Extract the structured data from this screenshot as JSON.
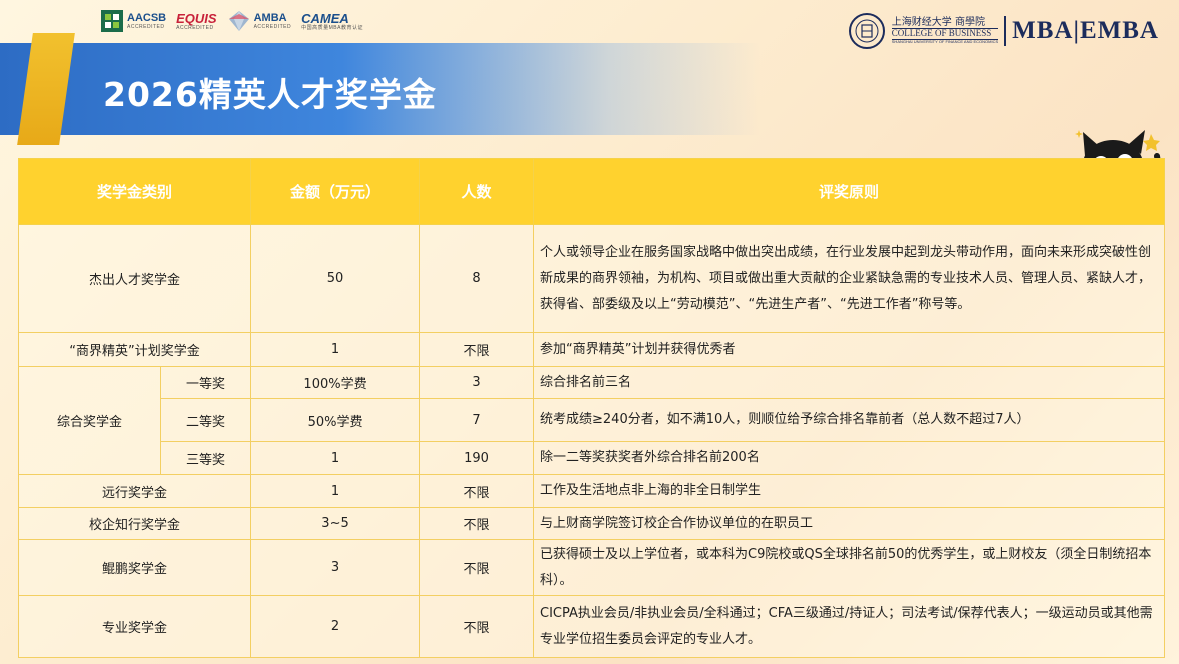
{
  "accreditations": [
    {
      "name": "AACSB",
      "sub": "ACCREDITED",
      "icon": "aacsb-logo"
    },
    {
      "name": "EQUIS",
      "sub": "ACCREDITED",
      "icon": "equis-logo"
    },
    {
      "name": "AMBA",
      "sub": "ACCREDITED",
      "icon": "amba-logo"
    },
    {
      "name": "CAMEA",
      "sub": "中国高质量MBA教育认证",
      "icon": "camea-logo"
    }
  ],
  "school": {
    "name_cn": "上海财经大学 商學院",
    "name_en": "COLLEGE OF BUSINESS",
    "name_tiny": "SHANGHAI UNIVERSITY OF FINANCE AND ECONOMICS",
    "program": "MBA|EMBA"
  },
  "page": {
    "title": "2026精英人才奖学金"
  },
  "table": {
    "headers": {
      "category": "奖学金类别",
      "amount": "金额（万元）",
      "count": "人数",
      "principle": "评奖原则"
    },
    "rows": {
      "outstanding": {
        "category": "杰出人才奖学金",
        "amount": "50",
        "count": "8",
        "principle": "个人或领导企业在服务国家战略中做出突出成绩，在行业发展中起到龙头带动作用，面向未来形成突破性创新成果的商界领袖，为机构、项目或做出重大贡献的企业紧缺急需的专业技术人员、管理人员、紧缺人才，获得省、部委级及以上“劳动模范”、“先进生产者”、“先进工作者”称号等。"
      },
      "elite": {
        "category": "“商界精英”计划奖学金",
        "amount": "1",
        "count": "不限",
        "principle": "参加“商界精英”计划并获得优秀者"
      },
      "comprehensive": {
        "category": "综合奖学金",
        "first": {
          "level": "一等奖",
          "amount": "100%学费",
          "count": "3",
          "principle": "综合排名前三名"
        },
        "second": {
          "level": "二等奖",
          "amount": "50%学费",
          "count": "7",
          "principle": "统考成绩≥240分者，如不满10人，则顺位给予综合排名靠前者（总人数不超过7人）"
        },
        "third": {
          "level": "三等奖",
          "amount": "1",
          "count": "190",
          "principle": "除一二等奖获奖者外综合排名前200名"
        }
      },
      "far": {
        "category": "远行奖学金",
        "amount": "1",
        "count": "不限",
        "principle": "工作及生活地点非上海的非全日制学生"
      },
      "coop": {
        "category": "校企知行奖学金",
        "amount": "3~5",
        "count": "不限",
        "principle": "与上财商学院签订校企合作协议单位的在职员工"
      },
      "kunpeng": {
        "category": "鲲鹏奖学金",
        "amount": "3",
        "count": "不限",
        "principle": "已获得硕士及以上学位者，或本科为C9院校或QS全球排名前50的优秀学生，或上财校友（须全日制统招本科）。"
      },
      "pro": {
        "category": "专业奖学金",
        "amount": "2",
        "count": "不限",
        "principle": "CICPA执业会员/非执业会员/全科通过；CFA三级通过/持证人；司法考试/保荐代表人；一级运动员或其他需专业学位招生委员会评定的专业人才。"
      }
    }
  },
  "colors": {
    "header_bg": "#ffd22e",
    "band_blue": "#2d6cc4",
    "gold": "#f2c12e",
    "navy": "#1c2c5c"
  }
}
